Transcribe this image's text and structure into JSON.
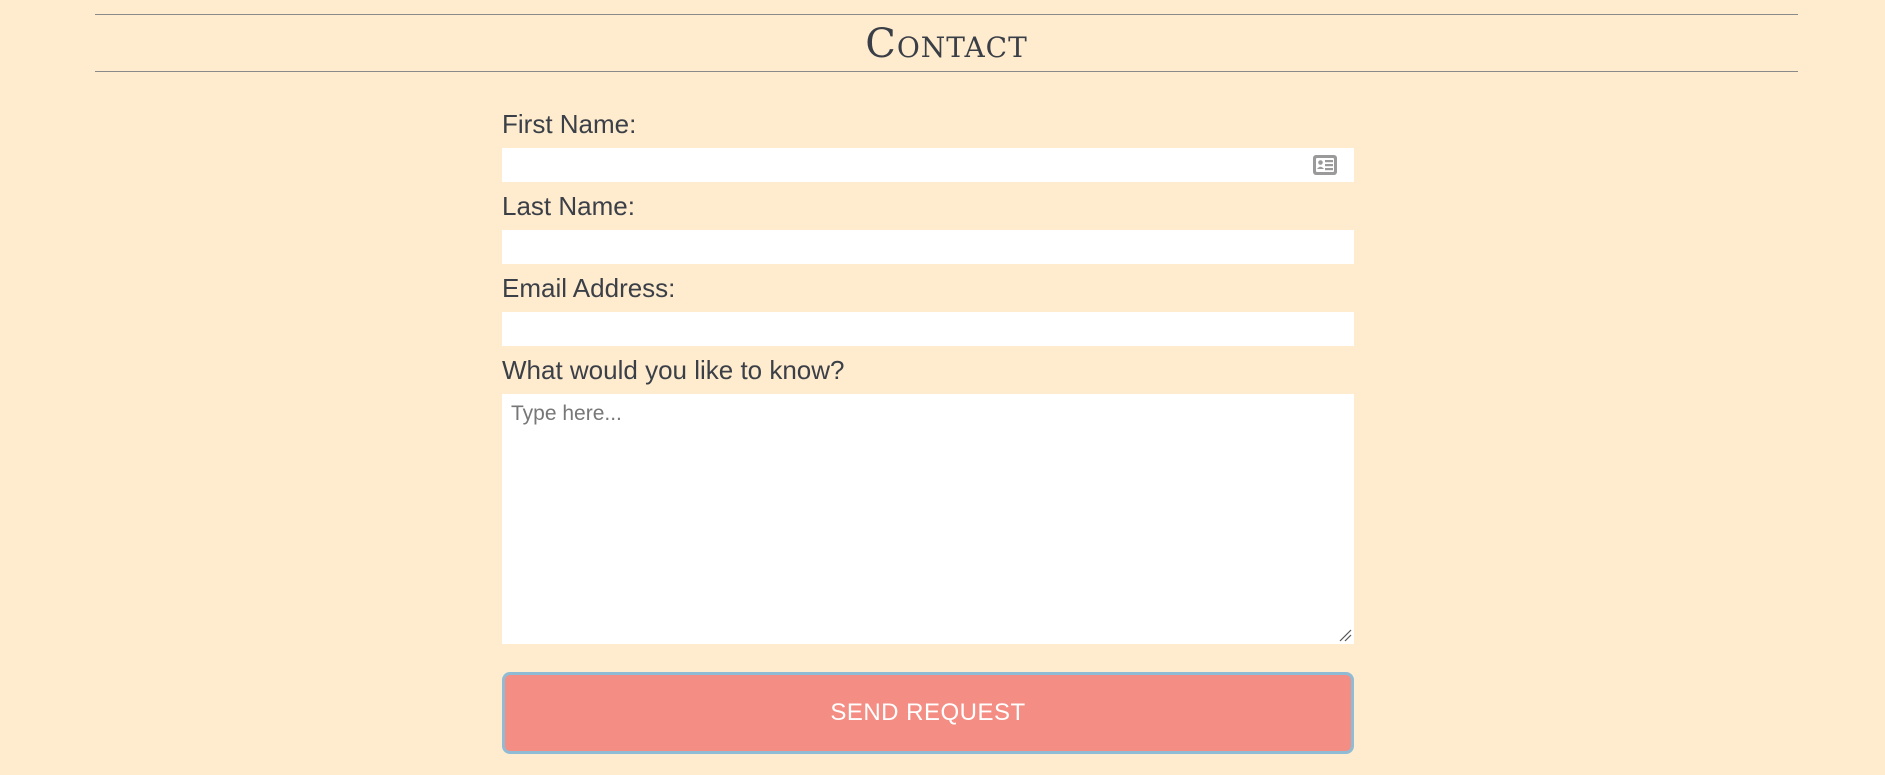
{
  "header": {
    "title": "Contact"
  },
  "form": {
    "first_name": {
      "label": "First Name:",
      "value": "",
      "icon": "contact-card-icon"
    },
    "last_name": {
      "label": "Last Name:",
      "value": ""
    },
    "email": {
      "label": "Email Address:",
      "value": ""
    },
    "message": {
      "label": "What would you like to know?",
      "placeholder": "Type here...",
      "value": ""
    },
    "submit_label": "SEND REQUEST"
  },
  "colors": {
    "background": "#ffebcd",
    "button": "#f48e84",
    "button_border": "#8fbcd4",
    "text": "#3b4048"
  }
}
